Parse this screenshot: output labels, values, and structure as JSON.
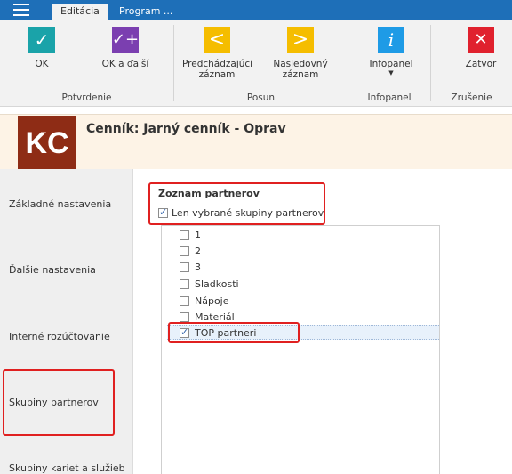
{
  "tabs": [
    "Editácia",
    "Program ..."
  ],
  "ribbon": {
    "buttons": [
      {
        "label": "OK",
        "icon": "check-icon",
        "color": "#1aa3a9"
      },
      {
        "label": "OK a ďalší",
        "icon": "check-plus-icon",
        "color": "#7b3fb0"
      },
      {
        "label": "Predchádzajúci záznam",
        "icon": "chevron-left-icon",
        "color": "#f5bd00"
      },
      {
        "label": "Nasledovný záznam",
        "icon": "chevron-right-icon",
        "color": "#f5bd00"
      },
      {
        "label": "Infopanel",
        "icon": "info-icon",
        "color": "#1e9be6"
      },
      {
        "label": "Zatvor",
        "icon": "close-icon",
        "color": "#e0212e"
      }
    ],
    "groups": [
      "Potvrdenie",
      "Posun",
      "Infopanel",
      "Zrušenie"
    ]
  },
  "header": {
    "logo": "KC",
    "title": "Cenník: Jarný cenník - Oprav"
  },
  "sidebar": {
    "items": [
      "Základné nastavenia",
      "Ďalšie nastavenia",
      "Interné rozúčtovanie",
      "Skupiny partnerov",
      "Skupiny kariet a služieb"
    ]
  },
  "section": {
    "title": "Zoznam partnerov",
    "filter_label": "Len vybrané skupiny partnerov",
    "filter_checked": true,
    "items": [
      {
        "label": "1",
        "checked": false
      },
      {
        "label": "2",
        "checked": false
      },
      {
        "label": "3",
        "checked": false
      },
      {
        "label": "Sladkosti",
        "checked": false
      },
      {
        "label": "Nápoje",
        "checked": false
      },
      {
        "label": "Materiál",
        "checked": false
      },
      {
        "label": "TOP partneri",
        "checked": true
      }
    ]
  },
  "colors": {
    "accent": "#1e6fb8",
    "highlight": "#e02020",
    "logo_bg": "#8e2c15"
  }
}
